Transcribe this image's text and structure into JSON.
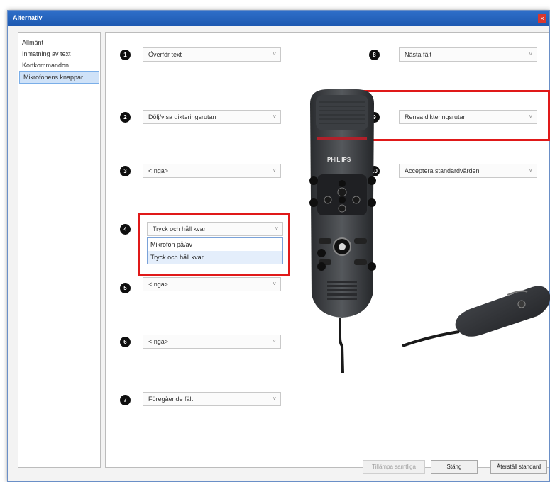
{
  "window": {
    "title": "Alternativ",
    "close_glyph": "×"
  },
  "sidebar": {
    "items": [
      {
        "label": "Allmänt"
      },
      {
        "label": "Inmatning av text"
      },
      {
        "label": "Kortkommandon"
      },
      {
        "label": "Mikrofonens knappar",
        "selected": true
      }
    ]
  },
  "buttons": [
    {
      "num": "1",
      "value": "Överför text"
    },
    {
      "num": "2",
      "value": "Dölj/visa dikteringsrutan"
    },
    {
      "num": "3",
      "value": "<Inga>"
    },
    {
      "num": "4",
      "value": "Tryck och håll kvar"
    },
    {
      "num": "5",
      "value": "<Inga>"
    },
    {
      "num": "6",
      "value": "<Inga>"
    },
    {
      "num": "7",
      "value": "Föregående fält"
    },
    {
      "num": "8",
      "value": "Nästa fält"
    },
    {
      "num": "9",
      "value": "Rensa dikteringsrutan"
    },
    {
      "num": "10",
      "value": "Acceptera standardvärden"
    }
  ],
  "dropdown_options": [
    "Mikrofon på/av",
    "Tryck och håll kvar"
  ],
  "device": {
    "brand": "PHILIPS",
    "brand_visible": "PHIL IPS"
  },
  "footer": {
    "apply_label": "Tillämpa samtliga",
    "close_label": "Stäng",
    "reset_label": "Återställ standard"
  },
  "dropdown_arrow": "˅",
  "highlight_color": "#e01919",
  "accent_color": "#1d58b0"
}
